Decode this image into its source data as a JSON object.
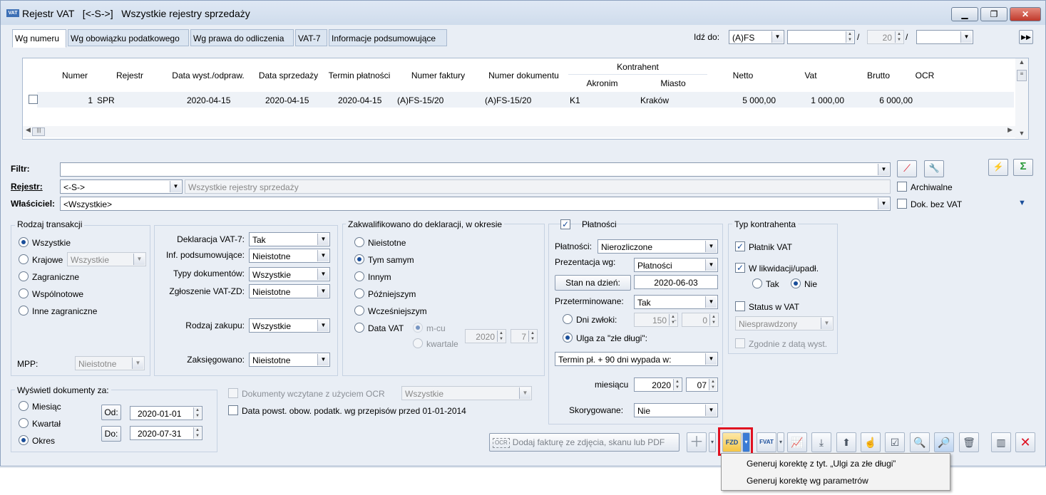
{
  "window": {
    "app_label": "VAT",
    "title": "Rejestr VAT   [<-S->]   Wszystkie rejestry sprzedaży"
  },
  "tabs": [
    "Wg numeru",
    "Wg obowiązku podatkowego",
    "Wg prawa do odliczenia",
    "VAT-7",
    "Informacje podsumowujące"
  ],
  "goto": {
    "label": "Idź do:",
    "value": "(A)FS",
    "number": "",
    "sep1": "/",
    "count": "20",
    "sep2": "/",
    "last": ""
  },
  "grid": {
    "headers": {
      "numer": "Numer",
      "rejestr": "Rejestr",
      "data_wyst": "Data wyst./odpraw.",
      "data_sprz": "Data sprzedaży",
      "termin": "Termin płatności",
      "nr_faktury": "Numer faktury",
      "nr_dok": "Numer dokumentu",
      "kontrahent": "Kontrahent",
      "akronim": "Akronim",
      "miasto": "Miasto",
      "netto": "Netto",
      "vat": "Vat",
      "brutto": "Brutto",
      "ocr": "OCR"
    },
    "row": {
      "numer": "1",
      "rejestr": "SPR",
      "data_wyst": "2020-04-15",
      "data_sprz": "2020-04-15",
      "termin": "2020-04-15",
      "nr_faktury": "(A)FS-15/20",
      "nr_dok": "(A)FS-15/20",
      "akronim": "K1",
      "miasto": "Kraków",
      "netto": "5 000,00",
      "vat": "1 000,00",
      "brutto": "6 000,00",
      "ocr": ""
    }
  },
  "filters": {
    "filtr_label": "Filtr:",
    "filtr_value": "",
    "rejestr_label": "Rejestr:",
    "rejestr_value": "<-S->",
    "rejestr_desc": "Wszystkie rejestry sprzedaży",
    "wlasciciel_label": "Właściciel:",
    "wlasciciel_value": "<Wszystkie>",
    "archiwalne": "Archiwalne",
    "dok_bez_vat": "Dok. bez VAT"
  },
  "rodzaj": {
    "title": "Rodzaj transakcji",
    "opt1": "Wszystkie",
    "opt2": "Krajowe",
    "opt2_value": "Wszystkie",
    "opt3": "Zagraniczne",
    "opt4": "Wspólnotowe",
    "opt5": "Inne zagraniczne",
    "mpp_label": "MPP:",
    "mpp_value": "Nieistotne"
  },
  "deklaracja": {
    "vat7_label": "Deklaracja VAT-7:",
    "vat7_value": "Tak",
    "inf_label": "Inf. podsumowujące:",
    "inf_value": "Nieistotne",
    "typy_label": "Typy dokumentów:",
    "typy_value": "Wszystkie",
    "zgl_label": "Zgłoszenie VAT-ZD:",
    "zgl_value": "Nieistotne",
    "zakup_label": "Rodzaj zakupu:",
    "zakup_value": "Wszystkie",
    "zaks_label": "Zaksięgowano:",
    "zaks_value": "Nieistotne"
  },
  "zakwalifikowano": {
    "title": "Zakwalifikowano do deklaracji, w okresie",
    "opt1": "Nieistotne",
    "opt2": "Tym samym",
    "opt3": "Innym",
    "opt4": "Późniejszym",
    "opt5": "Wcześniejszym",
    "opt6": "Data VAT",
    "mcu": "m-cu",
    "kwartale": "kwartale",
    "rok": "2020",
    "miesiac": "7"
  },
  "platnosci": {
    "title": "Płatności",
    "plat_label": "Płatności:",
    "plat_value": "Nierozliczone",
    "prez_label": "Prezentacja wg:",
    "prez_value": "Płatności",
    "stan_button": "Stan na dzień:",
    "stan_value": "2020-06-03",
    "przet_label": "Przeterminowane:",
    "przet_value": "Tak",
    "dni_label": "Dni zwłoki:",
    "dni_from": "150",
    "dni_sep": "-",
    "dni_to": "0",
    "ulga_label": "Ulga za \"złe długi\":",
    "termin_value": "Termin pł. + 90 dni wypada w:",
    "miesiacu_label": "miesiącu",
    "miesiacu_rok": "2020",
    "miesiacu_mc": "07",
    "skoryg_label": "Skorygowane:",
    "skoryg_value": "Nie"
  },
  "typ_kontrahenta": {
    "title": "Typ kontrahenta",
    "platnik": "Płatnik VAT",
    "likwidacja": "W likwidacji/upadł.",
    "tak": "Tak",
    "nie": "Nie",
    "status": "Status w VAT",
    "status_value": "Niesprawdzony",
    "zgodnie": "Zgodnie z datą wyst."
  },
  "wyswietl": {
    "title": "Wyświetl dokumenty za:",
    "opt1": "Miesiąc",
    "opt2": "Kwartał",
    "opt3": "Okres",
    "od_button": "Od:",
    "od_value": "2020-01-01",
    "do_button": "Do:",
    "do_value": "2020-07-31"
  },
  "ocr": {
    "ocr_docs": "Dokumenty wczytane z użyciem OCR",
    "ocr_docs_value": "Wszystkie",
    "data_powst": "Data powst. obow. podatk. wg przepisów przed 01-01-2014",
    "add_invoice": "Dodaj fakturę ze zdjęcia, skanu lub PDF",
    "ocr_icon_label": "OCR"
  },
  "toolbar": {
    "fzd_label": "FZD",
    "fvat_label": "FVAT"
  },
  "context_menu": {
    "item1": "Generuj korektę z tyt. „Ulgi za złe długi”",
    "item2": "Generuj korektę wg parametrów"
  },
  "colors": {
    "highlight_frame": "#e01020",
    "accent": "#1a4e9a"
  }
}
